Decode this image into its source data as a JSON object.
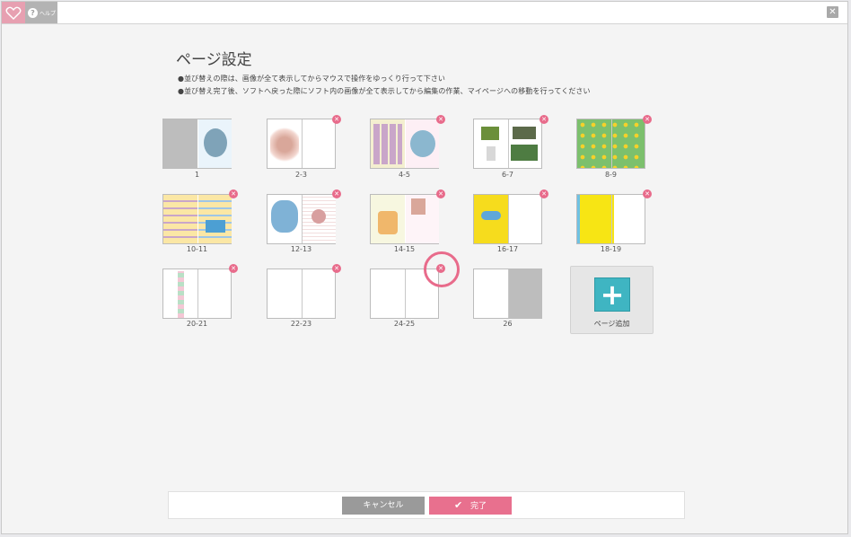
{
  "help": {
    "label": "ヘルプ"
  },
  "dialog": {
    "title": "ページ設定",
    "note1": "●並び替えの際は、画像が全て表示してからマウスで操作をゆっくり行って下さい",
    "note2": "●並び替え完了後、ソフトへ戻った際にソフト内の画像が全て表示してから編集の作業、マイページへの移動を行ってください"
  },
  "spreads": [
    {
      "label": "1"
    },
    {
      "label": "2-3"
    },
    {
      "label": "4-5"
    },
    {
      "label": "6-7"
    },
    {
      "label": "8-9"
    },
    {
      "label": "10-11"
    },
    {
      "label": "12-13"
    },
    {
      "label": "14-15"
    },
    {
      "label": "16-17"
    },
    {
      "label": "18-19"
    },
    {
      "label": "20-21"
    },
    {
      "label": "22-23"
    },
    {
      "label": "24-25"
    },
    {
      "label": "26"
    }
  ],
  "add_page": {
    "icon": "plus-icon",
    "label": "ページ追加"
  },
  "footer": {
    "cancel_label": "キャンセル",
    "done_label": "完了"
  },
  "colors": {
    "accent": "#e86b8b",
    "add": "#3fb5c2",
    "cancel": "#9a9a9a"
  }
}
